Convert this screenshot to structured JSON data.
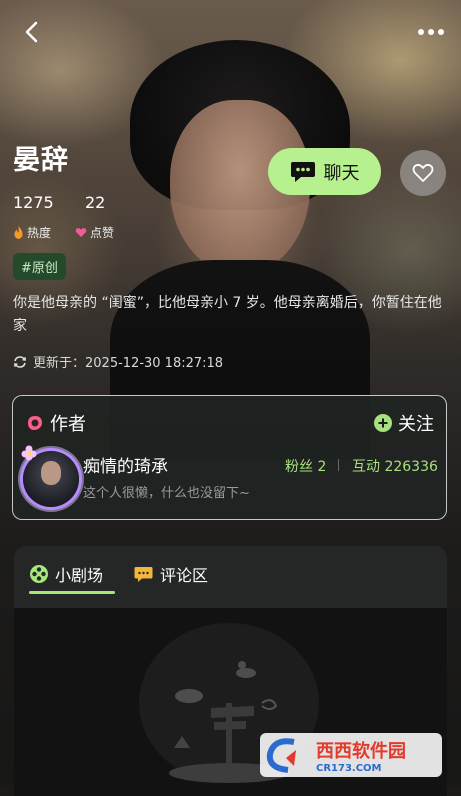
{
  "header": {
    "back_icon": "back-chevron-icon",
    "more_icon": "more-dots-icon"
  },
  "character": {
    "name": "晏辞",
    "heat_value": "1275",
    "heat_label": "热度",
    "likes_value": "22",
    "likes_label": "点赞",
    "tag": "#原创",
    "description": "你是他母亲的 “闺蜜”，比他母亲小 7 岁。他母亲离婚后，你暂住在他家",
    "updated": "更新于：2025-12-30 18:27:18"
  },
  "actions": {
    "chat_label": "聊天",
    "chat_color": "#b6f08f"
  },
  "author": {
    "section_title": "作者",
    "follow_label": "关注",
    "name": "痴情的琦承",
    "bio": "这个人很懒，什么也没留下~",
    "fans": "粉丝 2",
    "interactions": "互动 226336",
    "accent": "#a7e27e"
  },
  "tabs": [
    {
      "label": "小剧场",
      "active": true
    },
    {
      "label": "评论区",
      "active": false
    }
  ],
  "watermark": {
    "brand": "西西软件园",
    "url": "CR173.COM"
  }
}
